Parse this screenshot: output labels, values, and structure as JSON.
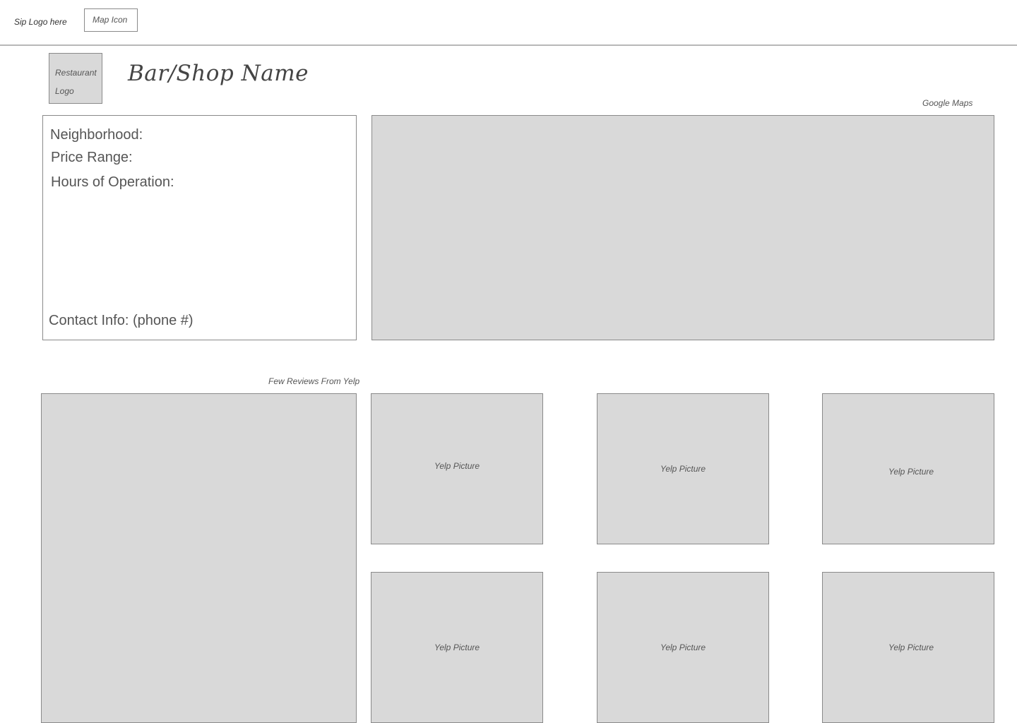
{
  "topbar": {
    "sip_logo": "Sip Logo here",
    "map_icon": "Map Icon"
  },
  "header": {
    "restaurant_logo_line1": "Restaurant",
    "restaurant_logo_line2": "Logo",
    "shop_name": "Bar/Shop Name",
    "google_maps_label": "Google Maps"
  },
  "info": {
    "neighborhood": "Neighborhood:",
    "price_range": "Price Range:",
    "hours": "Hours of Operation:",
    "contact": "Contact Info: (phone #)"
  },
  "reviews": {
    "label": "Few Reviews From Yelp"
  },
  "pictures": [
    "Yelp Picture",
    "Yelp Picture",
    "Yelp Picture",
    "Yelp Picture",
    "Yelp Picture",
    "Yelp Picture"
  ]
}
